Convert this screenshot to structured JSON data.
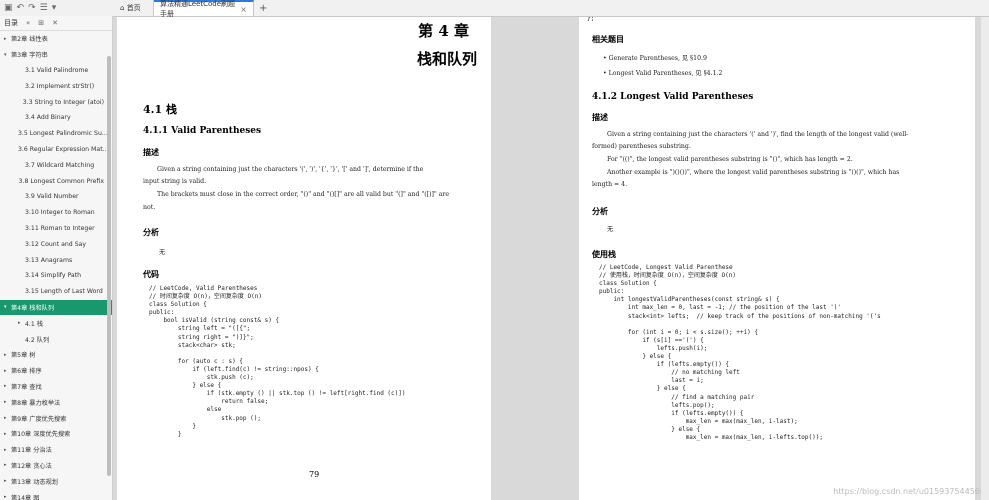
{
  "toolbar": {
    "home_tab": "首页",
    "doc_tab": "算法精通LeetCode刷题手册",
    "add": "+"
  },
  "sidebar": {
    "title": "目录",
    "items": [
      {
        "label": "第2章 线性表",
        "level": 1,
        "arrow": "▸"
      },
      {
        "label": "第3章 字符串",
        "level": 1,
        "arrow": "▾"
      },
      {
        "label": "3.1 Valid Palindrome",
        "level": 2
      },
      {
        "label": "3.2 Implement strStr()",
        "level": 2
      },
      {
        "label": "3.3 String to Integer (atoi)",
        "level": 2
      },
      {
        "label": "3.4 Add Binary",
        "level": 2
      },
      {
        "label": "3.5 Longest Palindromic Su...",
        "level": 2
      },
      {
        "label": "3.6 Regular Expression Mat...",
        "level": 2
      },
      {
        "label": "3.7 Wildcard Matching",
        "level": 2
      },
      {
        "label": "3.8 Longest Common Prefix",
        "level": 2
      },
      {
        "label": "3.9 Valid Number",
        "level": 2
      },
      {
        "label": "3.10 Integer to Roman",
        "level": 2
      },
      {
        "label": "3.11 Roman to Integer",
        "level": 2
      },
      {
        "label": "3.12 Count and Say",
        "level": 2
      },
      {
        "label": "3.13 Anagrams",
        "level": 2
      },
      {
        "label": "3.14 Simplify Path",
        "level": 2
      },
      {
        "label": "3.15 Length of Last Word",
        "level": 2
      },
      {
        "label": "第4章 栈和队列",
        "level": 1,
        "arrow": "▾",
        "active": true
      },
      {
        "label": "4.1 栈",
        "level": 2,
        "arrow": "▸"
      },
      {
        "label": "4.2 队列",
        "level": 2
      },
      {
        "label": "第5章 树",
        "level": 1,
        "arrow": "▸"
      },
      {
        "label": "第6章 排序",
        "level": 1,
        "arrow": "▸"
      },
      {
        "label": "第7章 查找",
        "level": 1,
        "arrow": "▸"
      },
      {
        "label": "第8章 暴力枚举法",
        "level": 1,
        "arrow": "▸"
      },
      {
        "label": "第9章 广度优先搜索",
        "level": 1,
        "arrow": "▸"
      },
      {
        "label": "第10章 深度优先搜索",
        "level": 1,
        "arrow": "▸"
      },
      {
        "label": "第11章 分治法",
        "level": 1,
        "arrow": "▸"
      },
      {
        "label": "第12章 贪心法",
        "level": 1,
        "arrow": "▸"
      },
      {
        "label": "第13章 动态规划",
        "level": 1,
        "arrow": "▸"
      },
      {
        "label": "第14章 图",
        "level": 1,
        "arrow": "▸"
      }
    ]
  },
  "left_page": {
    "chapter_num": "第 4 章",
    "chapter_title": "栈和队列",
    "sec": "4.1   栈",
    "subsec": "4.1.1    Valid Parentheses",
    "desc_head": "描述",
    "desc_lines": [
      "Given a string containing just the characters '(', ')', '{', '}', '[' and ']', determine if the",
      "input string is valid.",
      "The brackets must close in the correct order, \"()\" and \"()[]\" are all valid but \"(]\" and \"([)]\" are",
      "not."
    ],
    "analysis_head": "分析",
    "analysis_text": "无",
    "code_head": "代码",
    "code": "// LeetCode, Valid Parentheses\n// 时间复杂度 O(n)，空间复杂度 O(n)\nclass Solution {\npublic:\n    bool isValid (string const& s) {\n        string left = \"([{\";\n        string right = \")]}\";\n        stack<char> stk;\n\n        for (auto c : s) {\n            if (left.find(c) != string::npos) {\n                stk.push (c);\n            } else {\n                if (stk.empty () || stk.top () != left[right.find (c)])\n                    return false;\n                else\n                    stk.pop ();\n            }\n        }",
    "page_number": "79"
  },
  "right_page": {
    "top_close": "};",
    "related_head": "相关题目",
    "related": [
      "Generate Parentheses, 见 §10.9",
      "Longest Valid Parentheses, 见 §4.1.2"
    ],
    "subsec": "4.1.2    Longest Valid Parentheses",
    "desc_head": "描述",
    "desc_lines": [
      "Given a string containing just the characters '(' and ')', find the length of the longest valid (well-",
      "formed) parentheses substring.",
      "For \"(()\", the longest valid parentheses substring is \"()\", which has length = 2.",
      "Another example is \")()())\", where the longest valid parentheses substring is \"()()\", which has",
      "length = 4."
    ],
    "analysis_head": "分析",
    "analysis_text": "无",
    "code_head": "使用栈",
    "code": "// LeetCode, Longest Valid Parenthese\n// 使用栈，时间复杂度 O(n)，空间复杂度 O(n)\nclass Solution {\npublic:\n    int longestValidParentheses(const string& s) {\n        int max_len = 0, last = -1; // the position of the last ')'\n        stack<int> lefts;  // keep track of the positions of non-matching '('s\n\n        for (int i = 0; i < s.size(); ++i) {\n            if (s[i] =='(') {\n                lefts.push(i);\n            } else {\n                if (lefts.empty()) {\n                    // no matching left\n                    last = i;\n                } else {\n                    // find a matching pair\n                    lefts.pop();\n                    if (lefts.empty()) {\n                        max_len = max(max_len, i-last);\n                    } else {\n                        max_len = max(max_len, i-lefts.top());"
  },
  "watermark": "https://blog.csdn.net/u015937544566"
}
